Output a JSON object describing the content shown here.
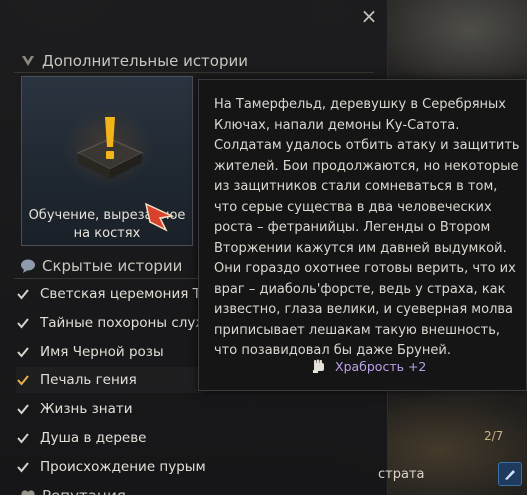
{
  "window": {
    "close_label": "×"
  },
  "sections": {
    "extra_stories_title": "Дополнительные истории",
    "hidden_stories_title": "Скрытые истории",
    "reputation_title": "Репутация"
  },
  "card": {
    "title": "Обучение, вырезанное на костях",
    "icon": "book-with-exclamation-icon"
  },
  "hidden_stories": [
    {
      "label": "Светская церемония Тыквы",
      "checked": true
    },
    {
      "label": "Тайные похороны служанки",
      "checked": true
    },
    {
      "label": "Имя Черной розы",
      "checked": true
    },
    {
      "label": "Печаль гения",
      "checked": true,
      "highlight": true
    },
    {
      "label": "Жизнь знати",
      "checked": true
    },
    {
      "label": "Душа в дереве",
      "checked": true
    },
    {
      "label": "Происхождение пурымов",
      "checked": true
    }
  ],
  "tooltip": {
    "text": "На Тамерфельд, деревушку в Серебряных Ключах, напали демоны Ку-Сатота. Солдатам удалось отбить атаку и защитить жителей. Бои продолжаются, но некоторые из защитников стали сомневаться в том, что серые существа в два человеческих роста – фетранийцы. Легенды о Втором Вторжении кажутся им давней выдумкой. Они гораздо охотнее готовы верить, что их враг – диаболь'форсте, ведь у страха, как известно, глаза велики, и суеверная молва приписывает лешакам такую внешность, что позавидовал бы даже Бруней.",
    "reward_label": "Храбрость +2",
    "reward_icon": "fist-icon"
  },
  "right_side": {
    "page_count": "2/7",
    "bottom_text": "страта"
  },
  "colors": {
    "reward": "#b9a2e8",
    "checkmark": "#e8b04a",
    "accent_blue": "#3b6fa8"
  }
}
